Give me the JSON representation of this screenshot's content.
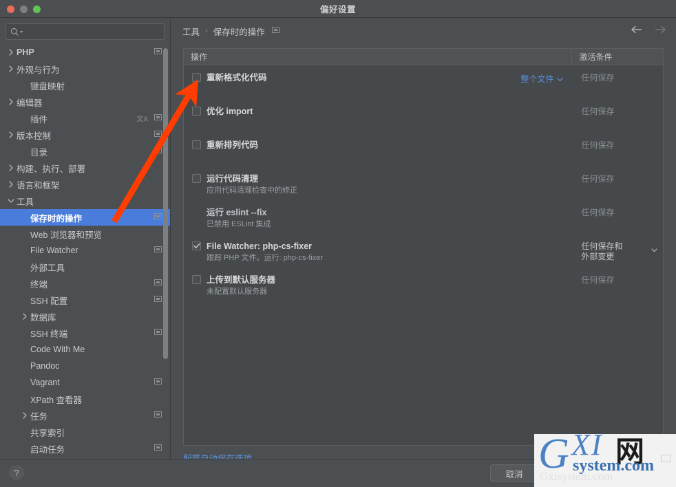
{
  "window": {
    "title": "偏好设置",
    "traffic_lights": [
      "close-button",
      "minimize-button",
      "zoom-button"
    ]
  },
  "sidebar": {
    "search": {
      "value": "",
      "placeholder": ""
    },
    "items": [
      {
        "label": "PHP",
        "indent": 0,
        "arrow": "right",
        "bold": true,
        "copy_badge": true,
        "lang_badge": false,
        "selected": false
      },
      {
        "label": "外观与行为",
        "indent": 0,
        "arrow": "right",
        "bold": false,
        "copy_badge": false,
        "lang_badge": false,
        "selected": false
      },
      {
        "label": "键盘映射",
        "indent": 1,
        "arrow": "none",
        "bold": false,
        "copy_badge": false,
        "lang_badge": false,
        "selected": false
      },
      {
        "label": "编辑器",
        "indent": 0,
        "arrow": "right",
        "bold": false,
        "copy_badge": false,
        "lang_badge": false,
        "selected": false
      },
      {
        "label": "插件",
        "indent": 1,
        "arrow": "none",
        "bold": false,
        "copy_badge": true,
        "lang_badge": true,
        "selected": false
      },
      {
        "label": "版本控制",
        "indent": 0,
        "arrow": "right",
        "bold": false,
        "copy_badge": true,
        "lang_badge": false,
        "selected": false
      },
      {
        "label": "目录",
        "indent": 1,
        "arrow": "none",
        "bold": false,
        "copy_badge": true,
        "lang_badge": false,
        "selected": false
      },
      {
        "label": "构建、执行、部署",
        "indent": 0,
        "arrow": "right",
        "bold": false,
        "copy_badge": false,
        "lang_badge": false,
        "selected": false
      },
      {
        "label": "语言和框架",
        "indent": 0,
        "arrow": "right",
        "bold": false,
        "copy_badge": false,
        "lang_badge": false,
        "selected": false
      },
      {
        "label": "工具",
        "indent": 0,
        "arrow": "down",
        "bold": false,
        "copy_badge": false,
        "lang_badge": false,
        "selected": false
      },
      {
        "label": "保存时的操作",
        "indent": 1,
        "arrow": "none",
        "bold": true,
        "copy_badge": true,
        "lang_badge": false,
        "selected": true
      },
      {
        "label": "Web 浏览器和预览",
        "indent": 1,
        "arrow": "none",
        "bold": false,
        "copy_badge": false,
        "lang_badge": false,
        "selected": false
      },
      {
        "label": "File Watcher",
        "indent": 1,
        "arrow": "none",
        "bold": false,
        "copy_badge": true,
        "lang_badge": false,
        "selected": false
      },
      {
        "label": "外部工具",
        "indent": 1,
        "arrow": "none",
        "bold": false,
        "copy_badge": false,
        "lang_badge": false,
        "selected": false
      },
      {
        "label": "终端",
        "indent": 1,
        "arrow": "none",
        "bold": false,
        "copy_badge": true,
        "lang_badge": false,
        "selected": false
      },
      {
        "label": "SSH 配置",
        "indent": 1,
        "arrow": "none",
        "bold": false,
        "copy_badge": true,
        "lang_badge": false,
        "selected": false
      },
      {
        "label": "数据库",
        "indent": 1,
        "arrow": "right",
        "bold": false,
        "copy_badge": false,
        "lang_badge": false,
        "selected": false
      },
      {
        "label": "SSH 终端",
        "indent": 1,
        "arrow": "none",
        "bold": false,
        "copy_badge": true,
        "lang_badge": false,
        "selected": false
      },
      {
        "label": "Code With Me",
        "indent": 1,
        "arrow": "none",
        "bold": false,
        "copy_badge": false,
        "lang_badge": false,
        "selected": false
      },
      {
        "label": "Pandoc",
        "indent": 1,
        "arrow": "none",
        "bold": false,
        "copy_badge": false,
        "lang_badge": false,
        "selected": false
      },
      {
        "label": "Vagrant",
        "indent": 1,
        "arrow": "none",
        "bold": false,
        "copy_badge": true,
        "lang_badge": false,
        "selected": false
      },
      {
        "label": "XPath 查看器",
        "indent": 1,
        "arrow": "none",
        "bold": false,
        "copy_badge": false,
        "lang_badge": false,
        "selected": false
      },
      {
        "label": "任务",
        "indent": 1,
        "arrow": "right",
        "bold": false,
        "copy_badge": true,
        "lang_badge": false,
        "selected": false
      },
      {
        "label": "共享索引",
        "indent": 1,
        "arrow": "none",
        "bold": false,
        "copy_badge": false,
        "lang_badge": false,
        "selected": false
      },
      {
        "label": "启动任务",
        "indent": 1,
        "arrow": "none",
        "bold": false,
        "copy_badge": true,
        "lang_badge": false,
        "selected": false
      }
    ]
  },
  "content": {
    "breadcrumb": {
      "root": "工具",
      "separator": "›",
      "current": "保存时的操作"
    },
    "nav": {
      "back": "back-arrow",
      "forward": "forward-arrow"
    },
    "table": {
      "headers": {
        "action": "操作",
        "condition": "激活条件"
      },
      "rows": [
        {
          "checked": false,
          "has_checkbox": true,
          "title": "重新格式化代码",
          "subtitle": "",
          "scope_link": "整个文件",
          "condition": "任何保存",
          "condition_strong": false,
          "condition_caret": false
        },
        {
          "checked": false,
          "has_checkbox": true,
          "title": "优化 import",
          "subtitle": "",
          "scope_link": "",
          "condition": "任何保存",
          "condition_strong": false,
          "condition_caret": false
        },
        {
          "checked": false,
          "has_checkbox": true,
          "title": "重新排列代码",
          "subtitle": "",
          "scope_link": "",
          "condition": "任何保存",
          "condition_strong": false,
          "condition_caret": false
        },
        {
          "checked": false,
          "has_checkbox": true,
          "title": "运行代码清理",
          "subtitle": "应用代码清理检查中的修正",
          "scope_link": "",
          "condition": "任何保存",
          "condition_strong": false,
          "condition_caret": false
        },
        {
          "checked": false,
          "has_checkbox": false,
          "title": "运行 eslint --fix",
          "subtitle": "已禁用 ESLint 集成",
          "scope_link": "",
          "condition": "任何保存",
          "condition_strong": false,
          "condition_caret": false
        },
        {
          "checked": true,
          "has_checkbox": true,
          "title": "File Watcher: php-cs-fixer",
          "subtitle": "跟踪 PHP 文件。运行: php-cs-fixer",
          "scope_link": "",
          "condition": "任何保存和\n外部变更",
          "condition_strong": true,
          "condition_caret": true
        },
        {
          "checked": false,
          "has_checkbox": true,
          "title": "上传到默认服务器",
          "subtitle": "未配置默认服务器",
          "scope_link": "",
          "condition": "任何保存",
          "condition_strong": false,
          "condition_caret": false
        }
      ]
    },
    "footer_link": "配置自动保存选项..."
  },
  "bottom_bar": {
    "help": "?",
    "cancel_label": "取消"
  },
  "watermark": {
    "g": "G",
    "xi": "XI",
    "wang": "网",
    "system": "system.com",
    "ghost": "Gxisystem.com"
  },
  "colors": {
    "accent_selection": "#4a7ddb",
    "link": "#5b90d8",
    "panel_bg": "#4b4f52",
    "table_bg": "#45494c",
    "annotation_arrow": "#ff3d00"
  }
}
